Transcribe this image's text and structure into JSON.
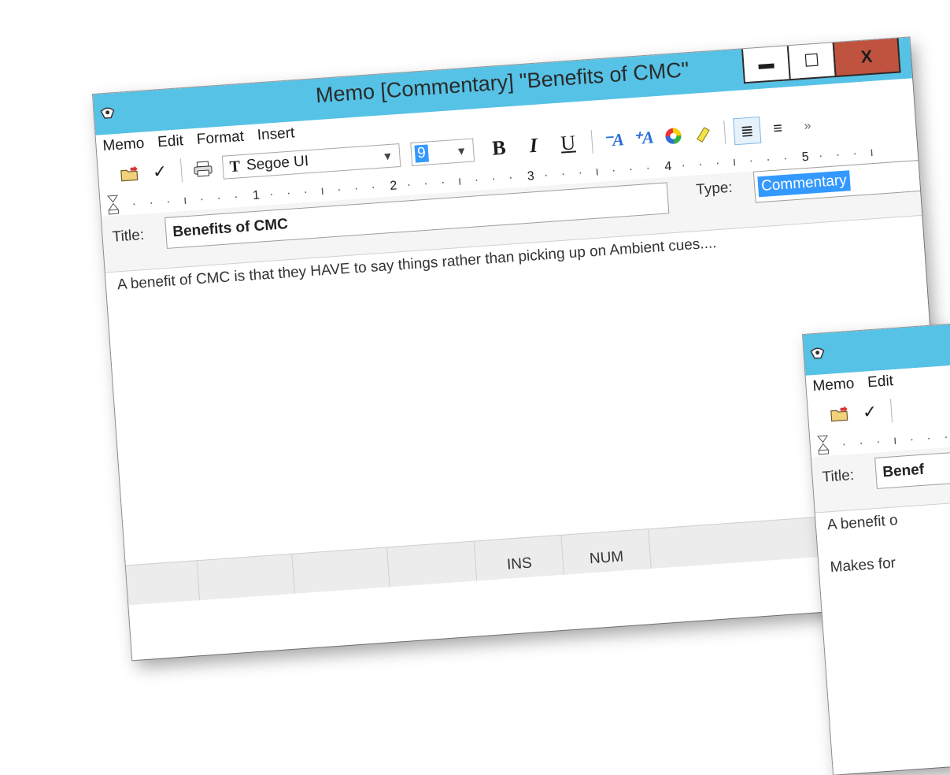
{
  "main_window": {
    "title": "Memo [Commentary] \"Benefits of CMC\"",
    "menu": [
      "Memo",
      "Edit",
      "Format",
      "Insert"
    ],
    "window_buttons": {
      "minimize": "▬",
      "maximize": "☐",
      "close": "X"
    },
    "toolbar": {
      "font_name": "Segoe UI",
      "font_size": "9",
      "bold": "B",
      "italic": "I",
      "underline": "U",
      "overflow": "»"
    },
    "ruler_numbers": [
      "1",
      "2",
      "3",
      "4",
      "5"
    ],
    "title_label": "Title:",
    "title_value": "Benefits of CMC",
    "type_label": "Type:",
    "type_value": "Commentary",
    "body_line_1": "A benefit of CMC is that they HAVE to say things rather than picking up on Ambient cues....",
    "status": [
      "INS",
      "NUM"
    ]
  },
  "second_window": {
    "menu": [
      "Memo",
      "Edit"
    ],
    "title_label": "Title:",
    "title_value": "Benef",
    "body_line_1": "A benefit o",
    "body_line_2": "Makes for"
  },
  "colors": {
    "titlebar": "#56c2e6",
    "close_button": "#c0533f",
    "selection": "#3399ff"
  }
}
